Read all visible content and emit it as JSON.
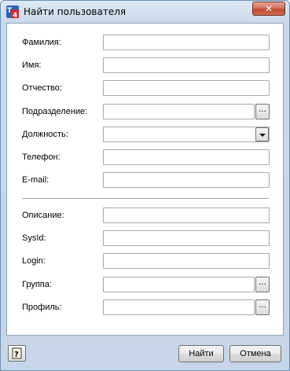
{
  "window": {
    "title": "Найти пользователя",
    "close_label": "✕"
  },
  "form": {
    "fields": [
      {
        "label": "Фамилия:",
        "value": ""
      },
      {
        "label": "Имя:",
        "value": ""
      },
      {
        "label": "Отчество:",
        "value": ""
      },
      {
        "label": "Подразделение:",
        "value": "",
        "button": "..."
      },
      {
        "label": "Должность:",
        "value": ""
      },
      {
        "label": "Телефон:",
        "value": ""
      },
      {
        "label": "E-mail:",
        "value": ""
      },
      {
        "label": "Описание:",
        "value": ""
      },
      {
        "label": "SysId:",
        "value": ""
      },
      {
        "label": "Login:",
        "value": ""
      },
      {
        "label": "Группа:",
        "value": "",
        "button": "..."
      },
      {
        "label": "Профиль:",
        "value": "",
        "button": "..."
      }
    ]
  },
  "buttons": {
    "find": "Найти",
    "cancel": "Отмена"
  },
  "icons": {
    "app": "t4-app-icon",
    "help": "help-icon"
  }
}
